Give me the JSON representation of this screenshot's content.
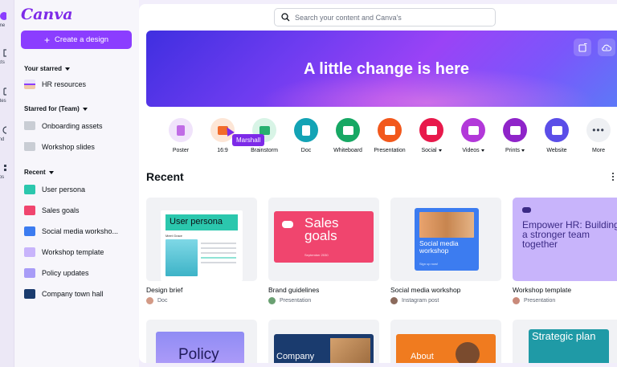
{
  "app": {
    "name": "Canva",
    "brand_color": "#8b3dff",
    "create_label": "Create a design"
  },
  "rail": [
    {
      "label": "me",
      "icon": "home-icon"
    },
    {
      "label": "cts",
      "icon": "projects-icon"
    },
    {
      "label": "ates",
      "icon": "templates-icon"
    },
    {
      "label": "nd",
      "icon": "brand-icon"
    },
    {
      "label": "ps",
      "icon": "apps-icon"
    }
  ],
  "sidebar": {
    "starred": {
      "title": "Your starred",
      "items": [
        {
          "label": "HR resources",
          "icon": "board-thumb"
        }
      ]
    },
    "team": {
      "title": "Starred for (Team)",
      "items": [
        {
          "label": "Onboarding assets",
          "icon": "folder-icon"
        },
        {
          "label": "Workshop slides",
          "icon": "folder-icon"
        }
      ]
    },
    "recent": {
      "title": "Recent",
      "items": [
        {
          "label": "User persona",
          "color": "#2bc7ad"
        },
        {
          "label": "Sales goals",
          "color": "#f0456e"
        },
        {
          "label": "Social media worksho...",
          "color": "#3c7cf0"
        },
        {
          "label": "Workshop template",
          "color": "#c8b4fb"
        },
        {
          "label": "Policy updates",
          "color": "#a89cf7"
        },
        {
          "label": "Company town hall",
          "color": "#1a3b6e"
        }
      ]
    }
  },
  "search": {
    "placeholder": "Search your content and Canva's"
  },
  "banner": {
    "title": "A little change is here"
  },
  "types": [
    {
      "label": "Poster",
      "color": "#f0e3fb",
      "glyph": "#c06ce6",
      "caret": false
    },
    {
      "label": "16:9",
      "color": "#fde6d6",
      "glyph": "#f26b2a",
      "caret": false
    },
    {
      "label": "Brainstorm",
      "color": "#d8f4e6",
      "glyph": "#28b070",
      "caret": false
    },
    {
      "label": "Doc",
      "color": "#13a3b5",
      "glyph": "#ffffff",
      "caret": false
    },
    {
      "label": "Whiteboard",
      "color": "#17a864",
      "glyph": "#ffffff",
      "caret": false
    },
    {
      "label": "Presentation",
      "color": "#f2581c",
      "glyph": "#ffffff",
      "caret": false
    },
    {
      "label": "Social",
      "color": "#e8194b",
      "glyph": "#ffffff",
      "caret": true
    },
    {
      "label": "Videos",
      "color": "#b238d9",
      "glyph": "#ffffff",
      "caret": true
    },
    {
      "label": "Prints",
      "color": "#8f24c9",
      "glyph": "#ffffff",
      "caret": true
    },
    {
      "label": "Website",
      "color": "#5b4ee8",
      "glyph": "#ffffff",
      "caret": false
    },
    {
      "label": "More",
      "color": "#eef0f3",
      "glyph": "#394152",
      "caret": false
    }
  ],
  "tooltip": {
    "label": "Marshall"
  },
  "recent": {
    "title": "Recent",
    "cards": [
      {
        "title": "Design brief",
        "meta": "Doc",
        "avatar": "#d39a86",
        "thumb_text": "User persona",
        "thumb_sub": "Meet Grace"
      },
      {
        "title": "Brand guidelines",
        "meta": "Presentation",
        "avatar": "#6aa072",
        "thumb_text": "Sales goals",
        "thumb_sub": "September 2030"
      },
      {
        "title": "Social media workshop",
        "meta": "Instagram post",
        "avatar": "#8b6a5c",
        "thumb_text": "Social media workshop",
        "thumb_sub": "Sign up now!"
      },
      {
        "title": "Workshop template",
        "meta": "Presentation",
        "avatar": "#c98a7a",
        "thumb_text": "Empower HR: Building a stronger team together",
        "thumb_sub": ""
      }
    ],
    "row2": [
      {
        "thumb_text": "Policy"
      },
      {
        "thumb_text": "Company"
      },
      {
        "thumb_text": "About"
      },
      {
        "thumb_text": "Strategic plan"
      }
    ]
  }
}
